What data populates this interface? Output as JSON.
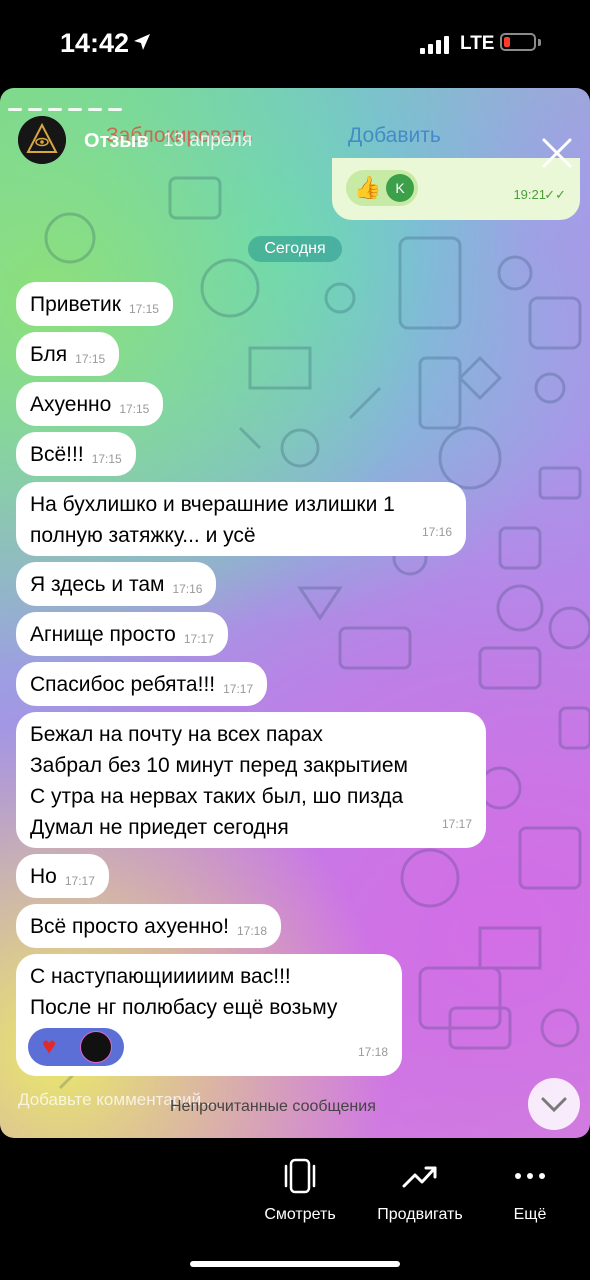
{
  "status_bar": {
    "time": "14:42",
    "network": "LTE"
  },
  "story": {
    "author": "Отзыв",
    "date": "13 апреля",
    "underlying_action_block": "Заблокировать",
    "underlying_action_add": "Добавить"
  },
  "chat": {
    "top_outgoing": {
      "reaction_letter": "K",
      "time": "19:21"
    },
    "date_separator": "Сегодня",
    "messages": [
      {
        "text": "Приветик",
        "time": "17:15"
      },
      {
        "text": "Бля",
        "time": "17:15"
      },
      {
        "text": "Ахуенно",
        "time": "17:15"
      },
      {
        "text": "Всё!!!",
        "time": "17:15"
      },
      {
        "text": "На бухлишко и вчерашние излишки 1\nполную затяжку... и усё",
        "time": "17:16"
      },
      {
        "text": "Я здесь и там",
        "time": "17:16"
      },
      {
        "text": "Агнище просто",
        "time": "17:17"
      },
      {
        "text": "Спасибос ребята!!!",
        "time": "17:17"
      },
      {
        "text": "Бежал на почту на всех парах\nЗабрал без 10 минут перед закрытием\nС утра на нервах таких был, шо пизда\nДумал не приедет сегодня",
        "time": "17:17"
      },
      {
        "text": "Но",
        "time": "17:17"
      },
      {
        "text": "Всё просто ахуенно!",
        "time": "17:18"
      },
      {
        "text": "С наступающииииим вас!!!\nПосле нг полюбасу ещё возьму",
        "time": "17:18"
      }
    ],
    "unread_label": "Непрочитанные сообщения"
  },
  "comment_placeholder": "Добавьте комментарий...",
  "bottom_bar": {
    "view": "Смотреть",
    "promote": "Продвигать",
    "more": "Ещё"
  }
}
